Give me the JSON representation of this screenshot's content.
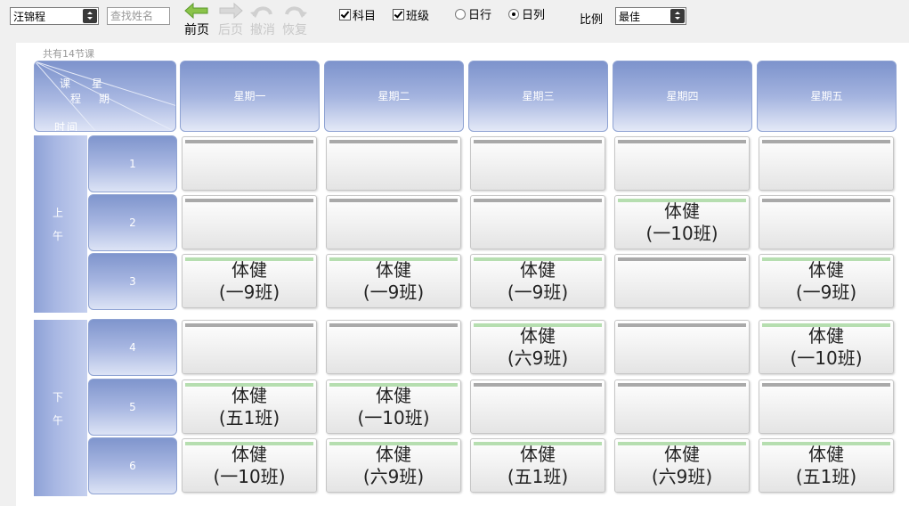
{
  "toolbar": {
    "teacher_select": "汪锦程",
    "search_placeholder": "查找姓名",
    "nav": [
      {
        "label": "前页",
        "icon": "left-arrow-icon"
      },
      {
        "label": "后页",
        "icon": "right-arrow-icon"
      },
      {
        "label": "撤消",
        "icon": "undo-icon"
      },
      {
        "label": "恢复",
        "icon": "redo-icon"
      }
    ],
    "checkboxes": [
      {
        "label": "科目",
        "checked": true
      },
      {
        "label": "班级",
        "checked": true
      }
    ],
    "radios": [
      {
        "label": "日行",
        "selected": false
      },
      {
        "label": "日列",
        "selected": true
      }
    ],
    "ratio_label": "比例",
    "ratio_select": "最佳"
  },
  "schedule": {
    "course_count": "共有14节课",
    "corner": {
      "ke": "课",
      "cheng": "程",
      "xing": "星",
      "qi": "期",
      "shijian": "时间"
    },
    "days": [
      "星期一",
      "星期二",
      "星期三",
      "星期四",
      "星期五"
    ],
    "groups": [
      {
        "chars": [
          "上",
          "午"
        ]
      },
      {
        "chars": [
          "下",
          "午"
        ]
      }
    ],
    "periods": [
      "1",
      "2",
      "3",
      "4",
      "5",
      "6"
    ],
    "cells": [
      [
        {
          "subject": "",
          "class": ""
        },
        {
          "subject": "",
          "class": ""
        },
        {
          "subject": "",
          "class": ""
        },
        {
          "subject": "",
          "class": ""
        },
        {
          "subject": "",
          "class": ""
        }
      ],
      [
        {
          "subject": "",
          "class": ""
        },
        {
          "subject": "",
          "class": ""
        },
        {
          "subject": "",
          "class": ""
        },
        {
          "subject": "体健",
          "class": "(一10班)"
        },
        {
          "subject": "",
          "class": ""
        }
      ],
      [
        {
          "subject": "体健",
          "class": "(一9班)"
        },
        {
          "subject": "体健",
          "class": "(一9班)"
        },
        {
          "subject": "体健",
          "class": "(一9班)"
        },
        {
          "subject": "",
          "class": ""
        },
        {
          "subject": "体健",
          "class": "(一9班)"
        }
      ],
      [
        {
          "subject": "",
          "class": ""
        },
        {
          "subject": "",
          "class": ""
        },
        {
          "subject": "体健",
          "class": "(六9班)"
        },
        {
          "subject": "",
          "class": ""
        },
        {
          "subject": "体健",
          "class": "(一10班)"
        }
      ],
      [
        {
          "subject": "体健",
          "class": "(五1班)"
        },
        {
          "subject": "体健",
          "class": "(一10班)"
        },
        {
          "subject": "",
          "class": ""
        },
        {
          "subject": "",
          "class": ""
        },
        {
          "subject": "",
          "class": ""
        }
      ],
      [
        {
          "subject": "体健",
          "class": "(一10班)"
        },
        {
          "subject": "体健",
          "class": "(六9班)"
        },
        {
          "subject": "体健",
          "class": "(五1班)"
        },
        {
          "subject": "体健",
          "class": "(六9班)"
        },
        {
          "subject": "体健",
          "class": "(五1班)"
        }
      ]
    ]
  }
}
